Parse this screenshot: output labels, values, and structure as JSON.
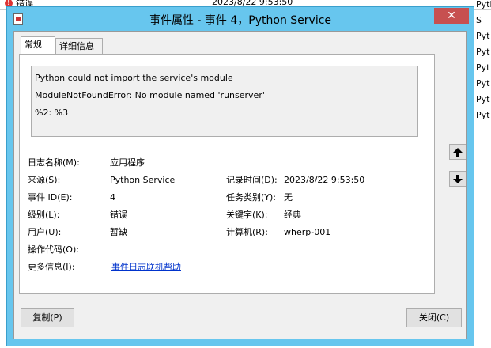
{
  "background": {
    "error_text": "错误",
    "date_text": "2023/8/22 9:53:50",
    "column_items": [
      "Python S",
      "Pyt",
      "Pyt",
      "Pyt",
      "Pyt",
      "Pyt",
      "Pyt"
    ]
  },
  "window": {
    "title": "事件属性 - 事件 4，Python Service",
    "close_glyph": "✕"
  },
  "tabs": [
    {
      "label": "常规",
      "active": true
    },
    {
      "label": "详细信息",
      "active": false
    }
  ],
  "message": {
    "lines": [
      "Python could not import the service's module",
      "ModuleNotFoundError: No module named 'runserver'",
      "%2: %3"
    ]
  },
  "fields": {
    "log_name": {
      "label": "日志名称(M):",
      "value": "应用程序"
    },
    "source": {
      "label": "来源(S):",
      "value": "Python Service"
    },
    "logged": {
      "label": "记录时间(D):",
      "value": "2023/8/22 9:53:50"
    },
    "event_id": {
      "label": "事件 ID(E):",
      "value": "4"
    },
    "task_category": {
      "label": "任务类别(Y):",
      "value": "无"
    },
    "level": {
      "label": "级别(L):",
      "value": "错误"
    },
    "keywords": {
      "label": "关键字(K):",
      "value": "经典"
    },
    "user": {
      "label": "用户(U):",
      "value": "暂缺"
    },
    "computer": {
      "label": "计算机(R):",
      "value": "wherp-001"
    },
    "opcode": {
      "label": "操作代码(O):",
      "value": ""
    },
    "more_info": {
      "label": "更多信息(I):",
      "link": "事件日志联机帮助"
    }
  },
  "buttons": {
    "copy": "复制(P)",
    "close": "关闭(C)"
  },
  "colors": {
    "title_bar": "#67c6ee",
    "close_button": "#c75050",
    "link": "#0033cc"
  }
}
